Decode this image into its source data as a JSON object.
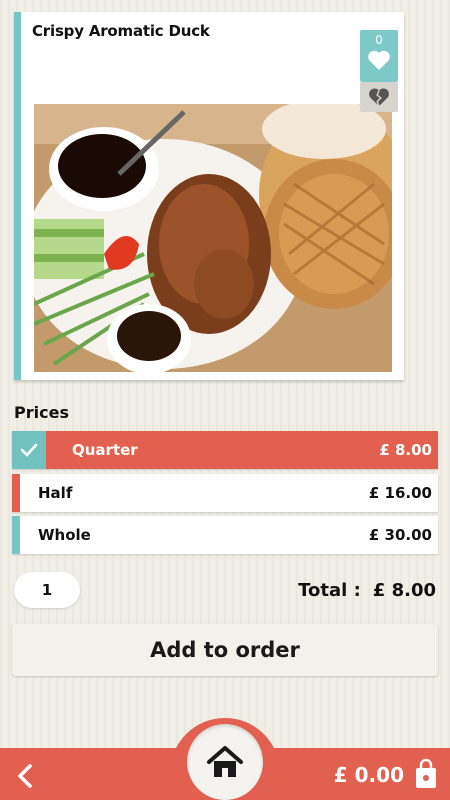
{
  "product": {
    "title": "Crispy Aromatic Duck",
    "likes": "0"
  },
  "prices": {
    "label": "Prices",
    "options": [
      {
        "name": "Quarter",
        "price": "£ 8.00",
        "selected": true
      },
      {
        "name": "Half",
        "price": "£ 16.00",
        "selected": false
      },
      {
        "name": "Whole",
        "price": "£ 30.00",
        "selected": false
      }
    ]
  },
  "order": {
    "quantity": "1",
    "total_label": "Total :",
    "total_value": "£ 8.00",
    "add_button": "Add to order"
  },
  "bottom_bar": {
    "cart_total": "£ 0.00"
  },
  "colors": {
    "accent_red": "#e2604f",
    "accent_teal": "#74c7c6"
  },
  "icons": [
    "heart-icon",
    "broken-heart-icon",
    "check-icon",
    "home-icon",
    "back-arrow-icon",
    "shopping-bag-icon"
  ]
}
